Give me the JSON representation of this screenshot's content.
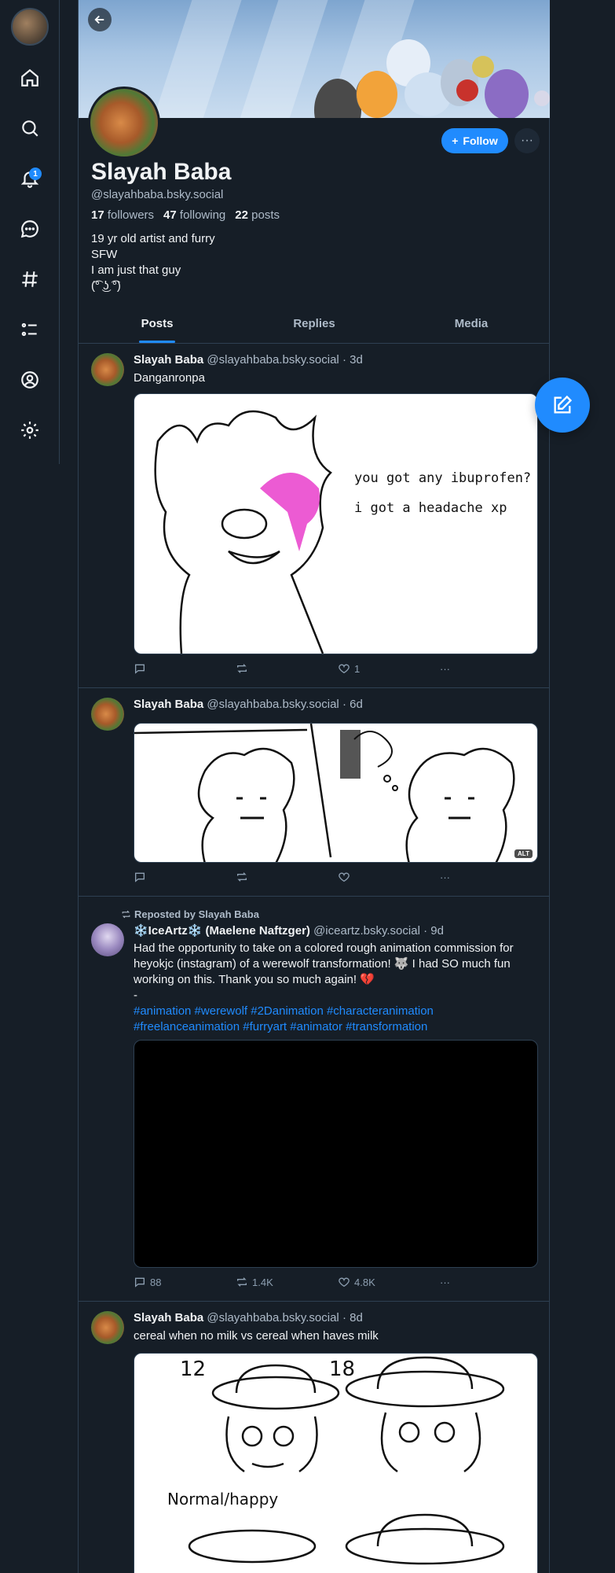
{
  "nav": {
    "items": [
      {
        "name": "home-icon"
      },
      {
        "name": "search-icon"
      },
      {
        "name": "bell-icon"
      },
      {
        "name": "chat-icon"
      },
      {
        "name": "hashtag-icon"
      },
      {
        "name": "list-icon"
      },
      {
        "name": "profile-icon"
      },
      {
        "name": "gear-icon"
      }
    ],
    "notification_count": "1"
  },
  "profile": {
    "name": "Slayah Baba",
    "handle": "@slayahbaba.bsky.social",
    "followers_count": "17",
    "followers_label": "followers",
    "following_count": "47",
    "following_label": "following",
    "posts_count": "22",
    "posts_label": "posts",
    "bio": [
      "19 yr old artist and furry",
      "SFW",
      "I am just that guy",
      "(͡° ͜ʖ ͡°)"
    ],
    "follow_label": "Follow",
    "more_label": "···"
  },
  "tabs": [
    {
      "label": "Posts",
      "active": true
    },
    {
      "label": "Replies",
      "active": false
    },
    {
      "label": "Media",
      "active": false
    }
  ],
  "posts": [
    {
      "author": "Slayah Baba",
      "handle": "@slayahbaba.bsky.social",
      "time": "· 3d",
      "text": "Danganronpa",
      "image_text": [
        "you got any ibuprofen?",
        "i got a headache xp"
      ],
      "replies": "",
      "reposts": "",
      "likes": "1"
    },
    {
      "author": "Slayah Baba",
      "handle": "@slayahbaba.bsky.social",
      "time": "· 6d",
      "alt": "ALT",
      "replies": "",
      "reposts": "",
      "likes": ""
    },
    {
      "repost_label": "Reposted by Slayah Baba",
      "author": "❄️IceArtz❄️ (Maelene Naftzger)",
      "handle": "@iceartz.bsky.social",
      "time": "· 9d",
      "text": "Had the opportunity to take on a colored rough animation commission for heyokjc (instagram) of a werewolf transformation! 🐺 I had SO much fun working on this. Thank you so much again! 💔",
      "dash": "-",
      "hashtags1": "#animation #werewolf #2Danimation #characteranimation",
      "hashtags2": "#freelanceanimation #furryart #animator #transformation",
      "replies": "88",
      "reposts": "1.4K",
      "likes": "4.8K"
    },
    {
      "author": "Slayah Baba",
      "handle": "@slayahbaba.bsky.social",
      "time": "· 8d",
      "text": "cereal when no milk vs cereal when haves milk",
      "image_text": [
        "12",
        "18",
        "Normal/happy"
      ]
    }
  ]
}
